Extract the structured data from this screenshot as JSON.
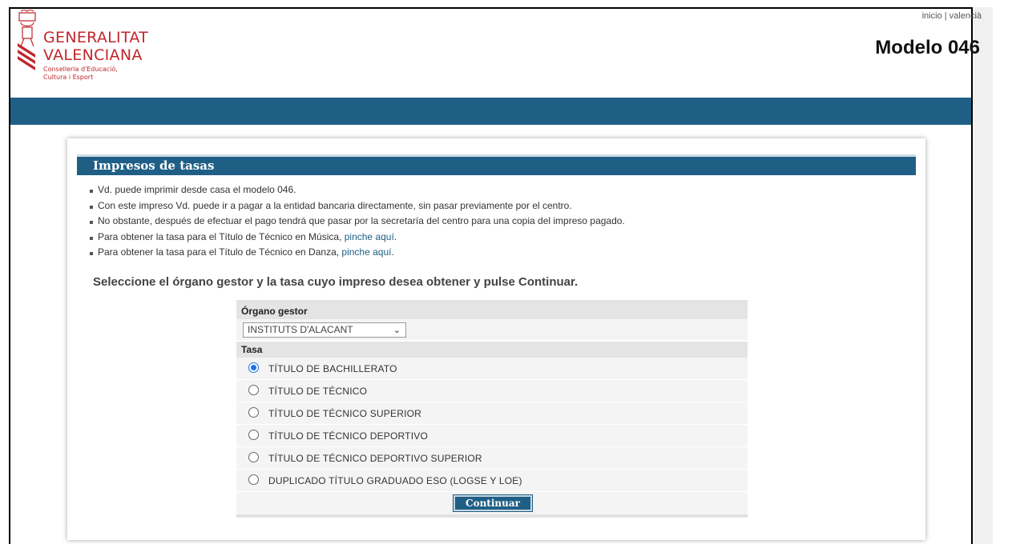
{
  "header": {
    "logo_title_line1": "GENERALITAT",
    "logo_title_line2": "VALENCIANA",
    "logo_sub_line1": "Conselleria d'Educació,",
    "logo_sub_line2": "Cultura i Esport",
    "top_link_inicio": "inicio",
    "top_link_sep": "|",
    "top_link_lang": "valencià",
    "page_title": "Modelo 046"
  },
  "panel": {
    "heading": "Impresos de tasas",
    "bullets": [
      {
        "text": "Vd. puede imprimir desde casa el modelo 046.",
        "link": ""
      },
      {
        "text": "Con este impreso Vd. puede ir a pagar a la entidad bancaria directamente, sin pasar previamente por el centro.",
        "link": ""
      },
      {
        "text": "No obstante, después de efectuar el pago tendrá que pasar por la secretaría del centro para una copia del impreso pagado.",
        "link": ""
      },
      {
        "text": "Para obtener la tasa para el Título de Técnico en Música, ",
        "link": "pinche aquí"
      },
      {
        "text": "Para obtener la tasa para el Título de Técnico en Danza, ",
        "link": "pinche aquí"
      }
    ],
    "instruction": "Seleccione el órgano gestor y la tasa cuyo impreso desea obtener y pulse Continuar."
  },
  "form": {
    "organo_label": "Órgano gestor",
    "organo_value": "INSTITUTS D'ALACANT",
    "tasa_label": "Tasa",
    "tasas": [
      {
        "label": "TÍTULO DE BACHILLERATO",
        "checked": true
      },
      {
        "label": "TÍTULO DE TÉCNICO",
        "checked": false
      },
      {
        "label": "TÍTULO DE TÉCNICO SUPERIOR",
        "checked": false
      },
      {
        "label": "TÍTULO DE TÉCNICO DEPORTIVO",
        "checked": false
      },
      {
        "label": "TÍTULO DE TÉCNICO DEPORTIVO SUPERIOR",
        "checked": false
      },
      {
        "label": "DUPLICADO TÍTULO GRADUADO ESO (LOGSE Y LOE)",
        "checked": false
      }
    ],
    "submit_label": "Continuar"
  },
  "colors": {
    "brand_blue": "#1f5f86",
    "brand_red": "#c0272d",
    "radio_blue": "#1a73e8"
  }
}
